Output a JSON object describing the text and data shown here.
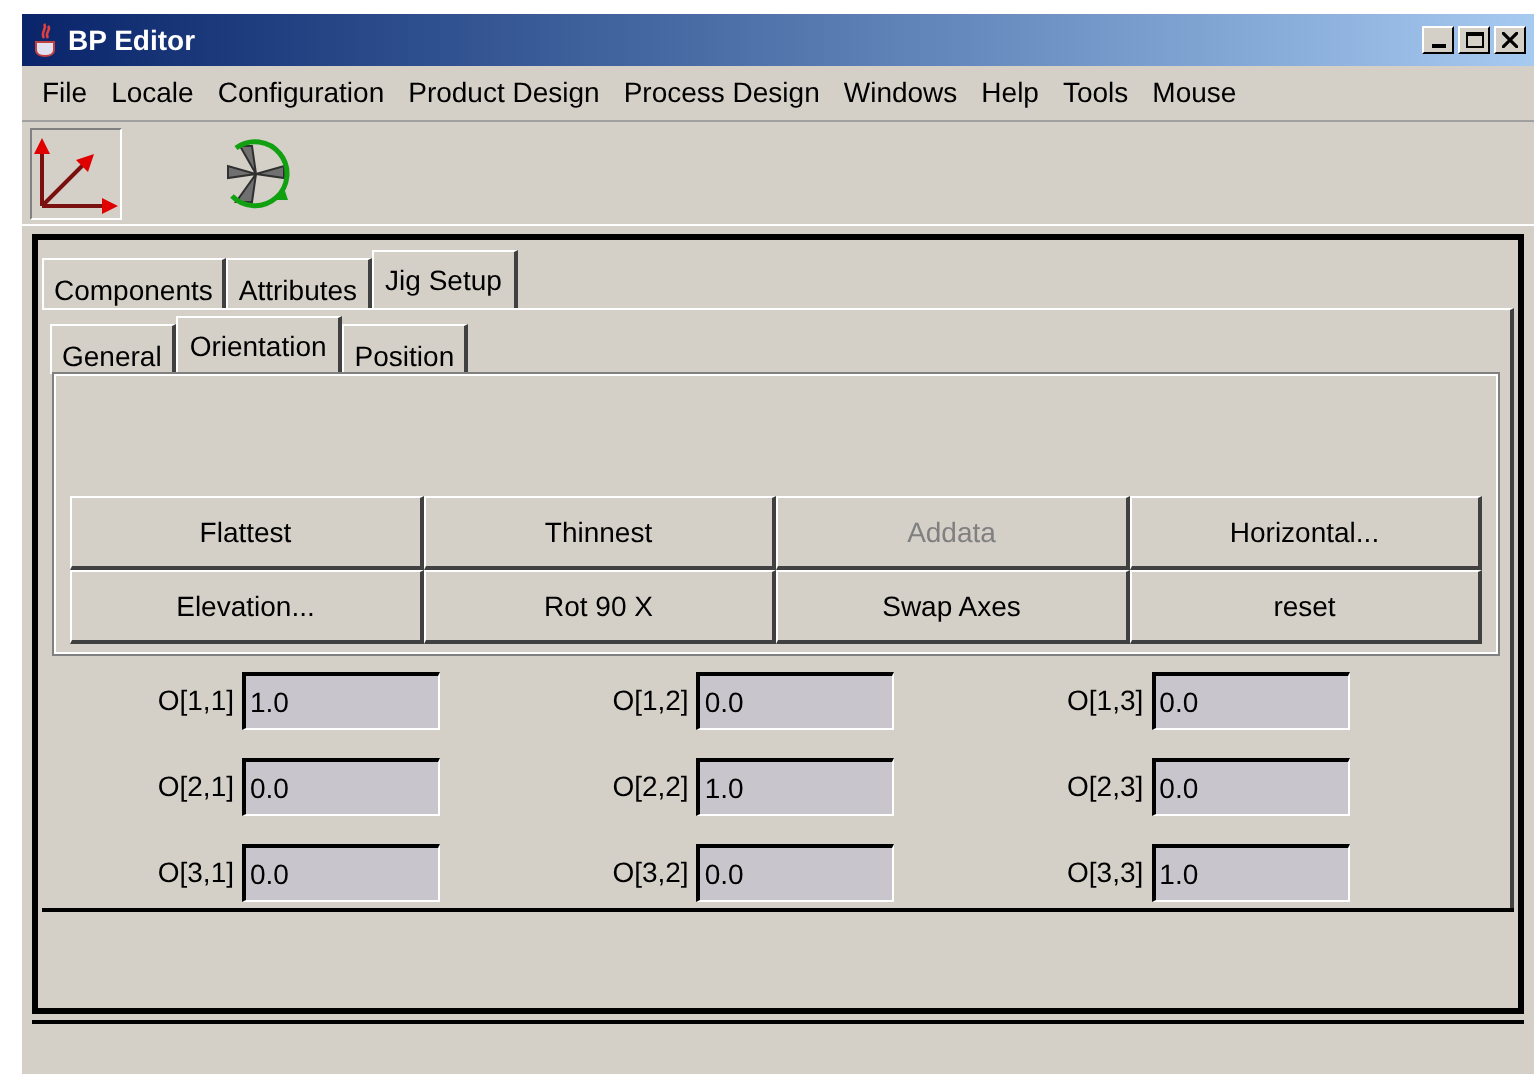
{
  "window": {
    "title": "BP Editor"
  },
  "menu": [
    "File",
    "Locale",
    "Configuration",
    "Product Design",
    "Process Design",
    "Windows",
    "Help",
    "Tools",
    "Mouse"
  ],
  "toolbar": [
    {
      "kind": "axes",
      "selected": true
    },
    {
      "kind": "rotate",
      "selected": false
    }
  ],
  "tabs": [
    {
      "label": "Components",
      "selected": false
    },
    {
      "label": "Attributes",
      "selected": false
    },
    {
      "label": "Jig Setup",
      "selected": true
    }
  ],
  "subtabs": [
    {
      "label": "General",
      "selected": false
    },
    {
      "label": "Orientation",
      "selected": true
    },
    {
      "label": "Position",
      "selected": false
    }
  ],
  "buttons": [
    {
      "label": "Flattest",
      "disabled": false
    },
    {
      "label": "Thinnest",
      "disabled": false
    },
    {
      "label": "Addata",
      "disabled": true
    },
    {
      "label": "Horizontal...",
      "disabled": false
    },
    {
      "label": "Elevation...",
      "disabled": false
    },
    {
      "label": "Rot 90 X",
      "disabled": false
    },
    {
      "label": "Swap Axes",
      "disabled": false
    },
    {
      "label": "reset",
      "disabled": false
    }
  ],
  "matrix": [
    {
      "label": "O[1,1]",
      "value": "1.0"
    },
    {
      "label": "O[1,2]",
      "value": "0.0"
    },
    {
      "label": "O[1,3]",
      "value": "0.0"
    },
    {
      "label": "O[2,1]",
      "value": "0.0"
    },
    {
      "label": "O[2,2]",
      "value": "1.0"
    },
    {
      "label": "O[2,3]",
      "value": "0.0"
    },
    {
      "label": "O[3,1]",
      "value": "0.0"
    },
    {
      "label": "O[3,2]",
      "value": "0.0"
    },
    {
      "label": "O[3,3]",
      "value": "1.0"
    }
  ]
}
